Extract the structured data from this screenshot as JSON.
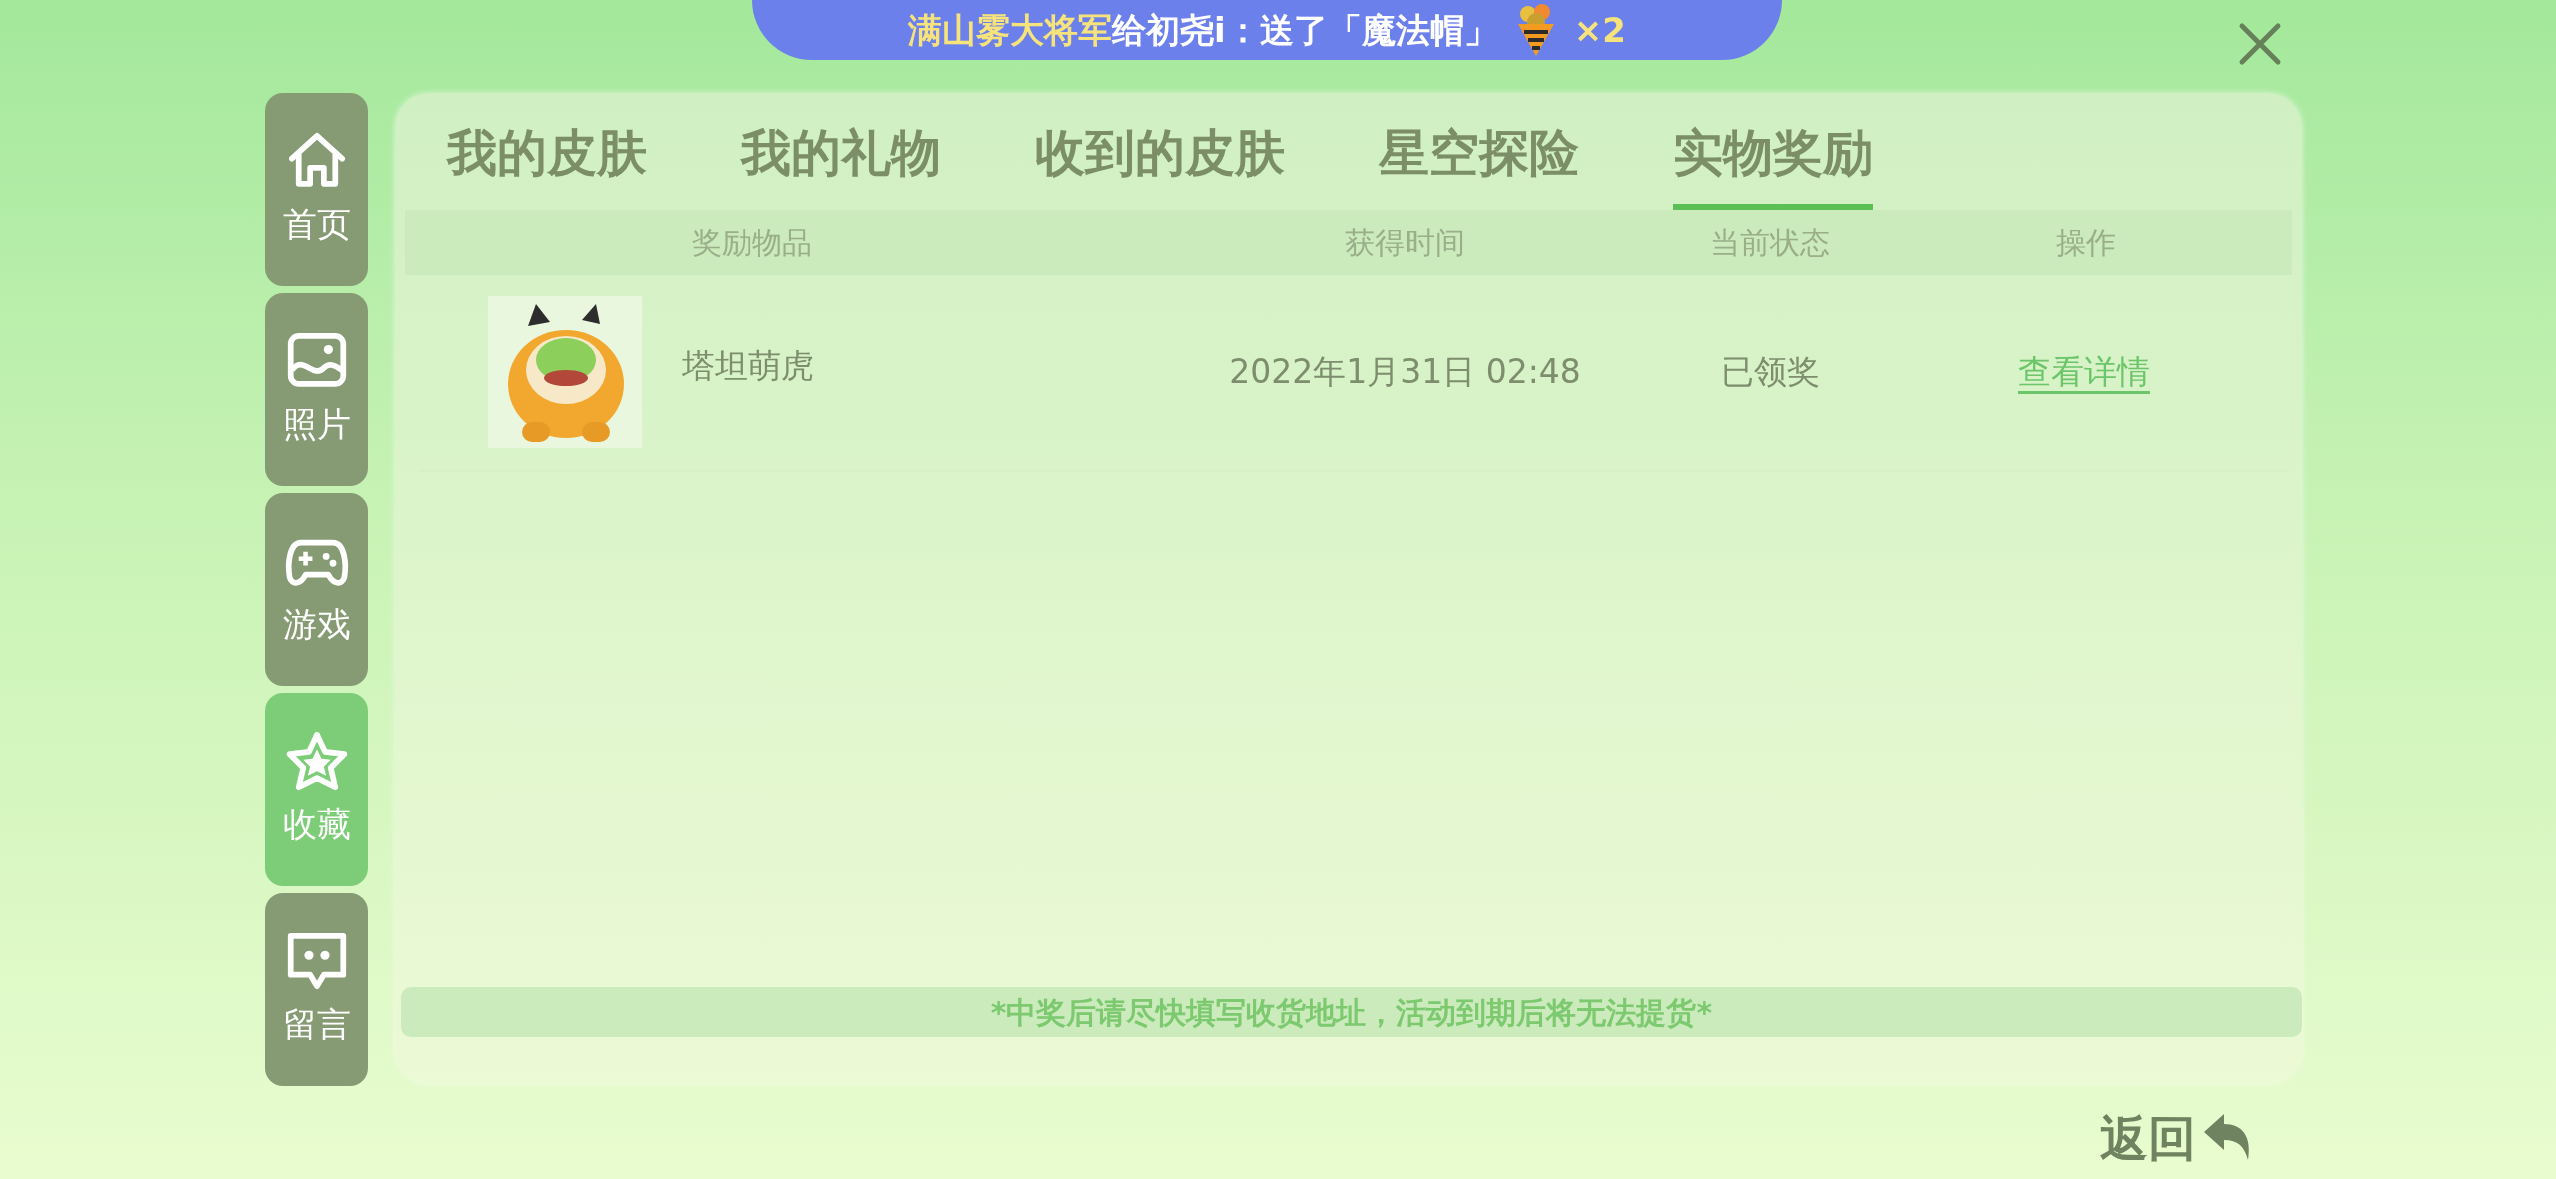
{
  "banner": {
    "sender": "满山雾大将军",
    "message": "给初尧i：送了「魔法帽」",
    "count": "×2"
  },
  "sidebar": {
    "items": [
      {
        "label": "首页",
        "kind": "home",
        "selected": false
      },
      {
        "label": "照片",
        "selected": false
      },
      {
        "label": "游戏",
        "kind": "gamepad",
        "selected": false
      },
      {
        "label": "收藏",
        "kind": "star",
        "selected": true
      },
      {
        "label": "留言",
        "kind": "message",
        "selected": false
      }
    ]
  },
  "tabs": [
    {
      "label": "我的皮肤",
      "selected": false
    },
    {
      "label": "我的礼物",
      "selected": false
    },
    {
      "label": "收到的皮肤",
      "selected": false
    },
    {
      "label": "星空探险",
      "selected": false
    },
    {
      "label": "实物奖励",
      "selected": true
    }
  ],
  "table": {
    "columns": [
      "奖励物品",
      "获得时间",
      "当前状态",
      "操作"
    ],
    "rows": [
      {
        "name": "塔坦萌虎",
        "time": "2022年1月31日 02:48",
        "status": "已领奖",
        "action": "查看详情"
      }
    ]
  },
  "notice": "*中奖后请尽快填写收货地址，活动到期后将无法提货*",
  "back_button": "返回"
}
